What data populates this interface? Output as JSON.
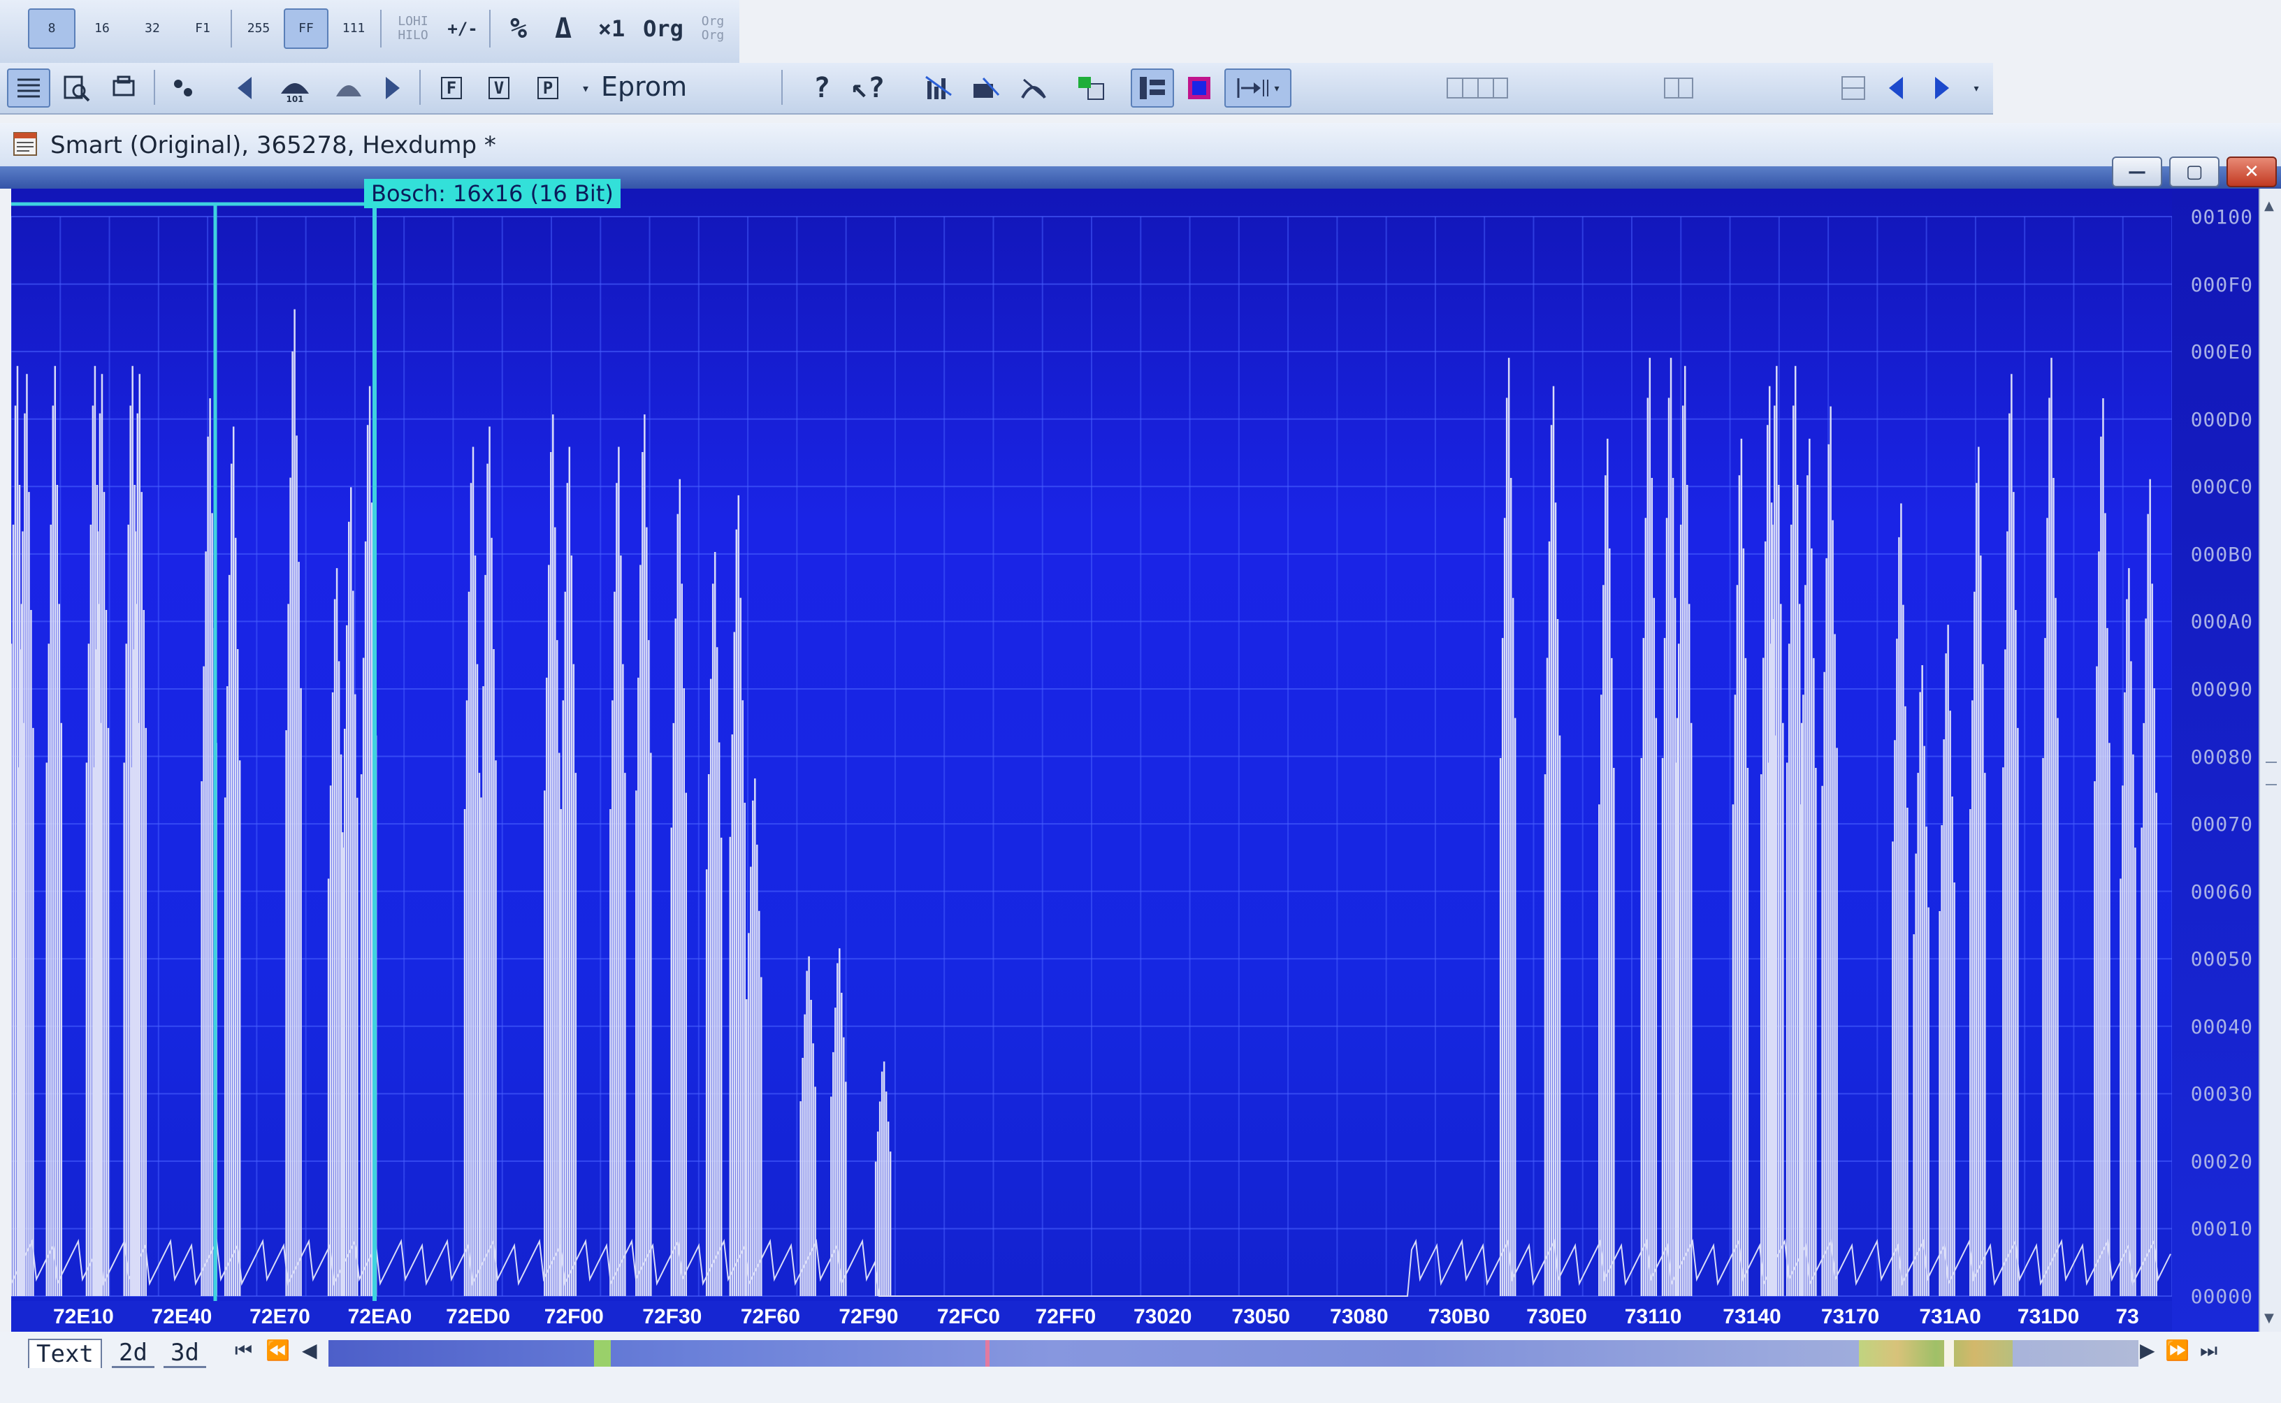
{
  "toolbar_top": {
    "buttons": [
      {
        "label": "8"
      },
      {
        "label": "16"
      },
      {
        "label": "32"
      },
      {
        "label": "F1"
      },
      {
        "label": "255"
      },
      {
        "label": "FF"
      },
      {
        "label": "111"
      },
      {
        "label": "LOHI HILO"
      },
      {
        "label": "+/-"
      },
      {
        "label": "%"
      },
      {
        "label": "Δ"
      },
      {
        "label": "×1"
      },
      {
        "label": "Org"
      },
      {
        "label": "Org Org"
      }
    ]
  },
  "toolbar_second": {
    "mode_label": "Eprom",
    "button_letters": [
      "F",
      "V",
      "P"
    ]
  },
  "window": {
    "title": "Smart (Original), 365278, Hexdump *",
    "min_label": "—",
    "max_label": "▢",
    "close_label": "✕"
  },
  "selection": {
    "label": "Bosch: 16x16 (16 Bit)"
  },
  "chart_data": {
    "type": "line",
    "title": "",
    "x_labels": [
      "72E10",
      "72E40",
      "72E70",
      "72EA0",
      "72ED0",
      "72F00",
      "72F30",
      "72F60",
      "72F90",
      "72FC0",
      "72FF0",
      "73020",
      "73050",
      "73080",
      "730B0",
      "730E0",
      "73110",
      "73140",
      "73170",
      "731A0",
      "731D0",
      "73"
    ],
    "y_labels": [
      "00100",
      "000F0",
      "000E0",
      "000D0",
      "000C0",
      "000B0",
      "000A0",
      "00090",
      "00080",
      "00070",
      "00060",
      "00050",
      "00040",
      "00030",
      "00020",
      "00010",
      "00000"
    ],
    "y_range": [
      0,
      256
    ],
    "grid": true,
    "spikes": [
      [
        0.0,
        230
      ],
      [
        0.4,
        228
      ],
      [
        1.6,
        230
      ],
      [
        3.3,
        230
      ],
      [
        3.6,
        228
      ],
      [
        4.9,
        230
      ],
      [
        5.2,
        228
      ],
      [
        8.2,
        222
      ],
      [
        9.2,
        215
      ],
      [
        11.8,
        244
      ],
      [
        13.6,
        180
      ],
      [
        14.2,
        200
      ],
      [
        15.0,
        225
      ],
      [
        19.4,
        210
      ],
      [
        20.1,
        215
      ],
      [
        22.8,
        218
      ],
      [
        23.5,
        210
      ],
      [
        25.6,
        210
      ],
      [
        26.7,
        218
      ],
      [
        28.2,
        202
      ],
      [
        29.7,
        184
      ],
      [
        30.7,
        198
      ],
      [
        31.4,
        128
      ],
      [
        33.7,
        84
      ],
      [
        35.0,
        86
      ],
      [
        36.9,
        58
      ],
      [
        63.5,
        232
      ],
      [
        65.4,
        225
      ],
      [
        67.7,
        212
      ],
      [
        69.5,
        232
      ],
      [
        70.4,
        232
      ],
      [
        71.0,
        230
      ],
      [
        73.4,
        212
      ],
      [
        74.6,
        225
      ],
      [
        74.9,
        230
      ],
      [
        75.7,
        230
      ],
      [
        76.3,
        212
      ],
      [
        77.2,
        220
      ],
      [
        80.2,
        196
      ],
      [
        81.1,
        156
      ],
      [
        82.2,
        166
      ],
      [
        83.5,
        210
      ],
      [
        84.9,
        228
      ],
      [
        86.6,
        232
      ],
      [
        88.8,
        222
      ],
      [
        89.9,
        180
      ],
      [
        90.8,
        202
      ]
    ]
  }
}
